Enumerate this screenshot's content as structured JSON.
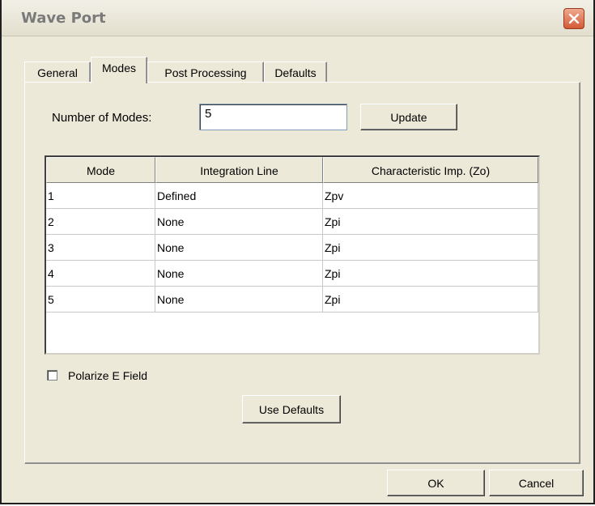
{
  "window": {
    "title": "Wave Port"
  },
  "tabs": [
    {
      "label": "General"
    },
    {
      "label": "Modes"
    },
    {
      "label": "Post Processing"
    },
    {
      "label": "Defaults"
    }
  ],
  "modes": {
    "number_label": "Number of Modes:",
    "number_value": "5",
    "update_label": "Update",
    "table": {
      "headers": [
        "Mode",
        "Integration Line",
        "Characteristic Imp. (Zo)"
      ],
      "rows": [
        [
          "1",
          "Defined",
          "Zpv"
        ],
        [
          "2",
          "None",
          "Zpi"
        ],
        [
          "3",
          "None",
          "Zpi"
        ],
        [
          "4",
          "None",
          "Zpi"
        ],
        [
          "5",
          "None",
          "Zpi"
        ]
      ]
    },
    "polarize_label": "Polarize E Field",
    "polarize_checked": false,
    "use_defaults_label": "Use Defaults"
  },
  "footer": {
    "ok_label": "OK",
    "cancel_label": "Cancel"
  },
  "colors": {
    "dialog_bg": "#ece9d8",
    "close_button": "#d35a37"
  },
  "icons": {
    "close": "close-icon"
  }
}
